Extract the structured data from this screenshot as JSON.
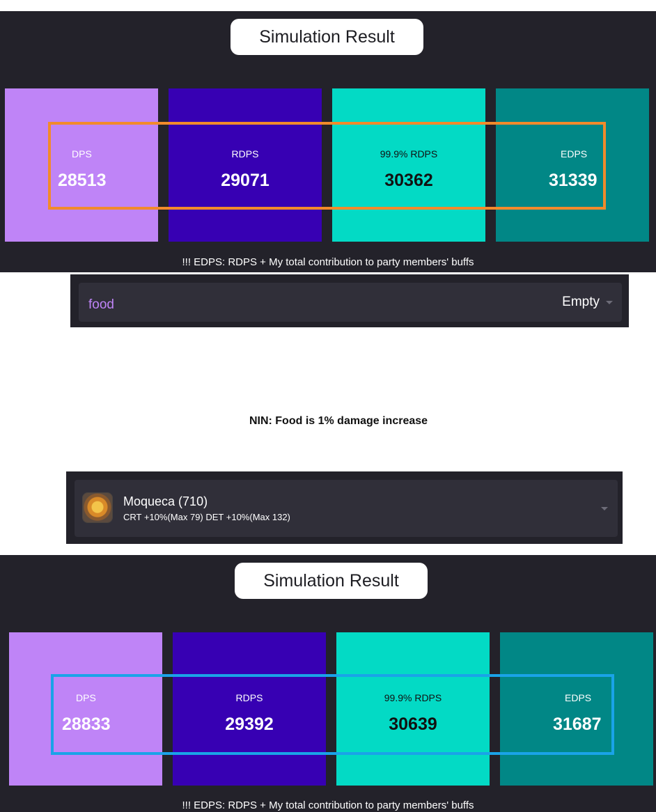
{
  "colors": {
    "panel_bg": "#23222a",
    "dps": "#bf84f7",
    "rdps": "#3700b3",
    "rdps999": "#03dac5",
    "edps": "#018786",
    "highlight_before": "#f28a2b",
    "highlight_after": "#1aa3e8",
    "select_placeholder": "#bf84f7"
  },
  "result_before": {
    "title": "Simulation Result",
    "cards": [
      {
        "label": "DPS",
        "value": "28513"
      },
      {
        "label": "RDPS",
        "value": "29071"
      },
      {
        "label": "99.9% RDPS",
        "value": "30362"
      },
      {
        "label": "EDPS",
        "value": "31339"
      }
    ],
    "note": "!!! EDPS: RDPS + My total contribution to party members' buffs"
  },
  "food_select_empty": {
    "placeholder": "food",
    "value": "Empty",
    "icon": "chevron-down-icon"
  },
  "annotation": "NIN: Food is 1% damage increase",
  "food_select_filled": {
    "name": "Moqueca (710)",
    "stats": "CRT +10%(Max 79) DET +10%(Max 132)",
    "icon": "moqueca-food-icon"
  },
  "result_after": {
    "title": "Simulation Result",
    "cards": [
      {
        "label": "DPS",
        "value": "28833"
      },
      {
        "label": "RDPS",
        "value": "29392"
      },
      {
        "label": "99.9% RDPS",
        "value": "30639"
      },
      {
        "label": "EDPS",
        "value": "31687"
      }
    ],
    "note": "!!! EDPS: RDPS + My total contribution to party members' buffs"
  }
}
